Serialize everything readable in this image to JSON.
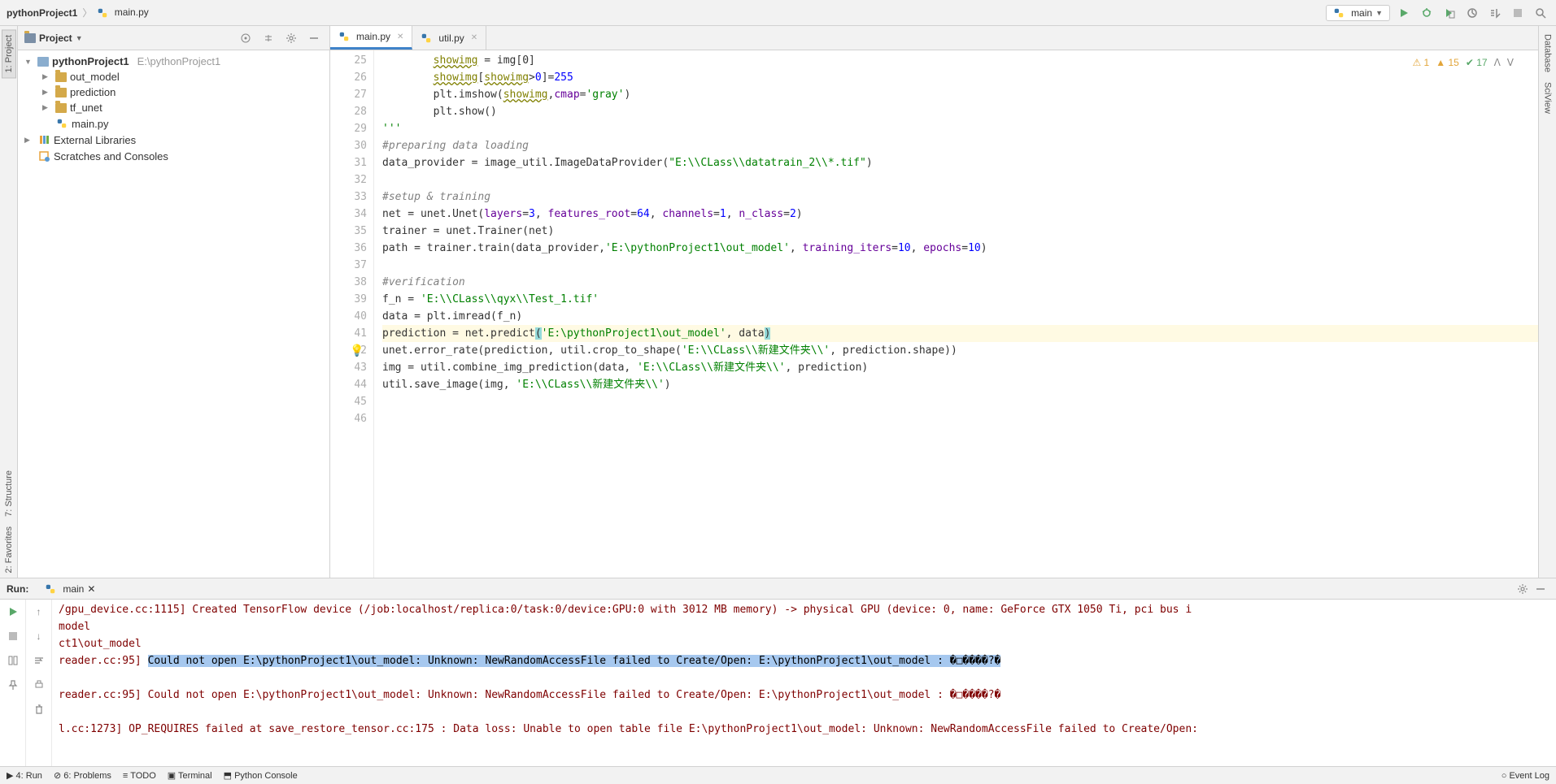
{
  "breadcrumb": {
    "project": "pythonProject1",
    "file": "main.py"
  },
  "runConfig": "main",
  "projectPanel": {
    "title": "Project",
    "root": {
      "name": "pythonProject1",
      "path": "E:\\pythonProject1"
    },
    "items": [
      {
        "name": "out_model",
        "type": "folder"
      },
      {
        "name": "prediction",
        "type": "folder"
      },
      {
        "name": "tf_unet",
        "type": "folder"
      },
      {
        "name": "main.py",
        "type": "py"
      }
    ],
    "external": "External Libraries",
    "scratches": "Scratches and Consoles"
  },
  "tabs": [
    {
      "label": "main.py",
      "active": true
    },
    {
      "label": "util.py",
      "active": false
    }
  ],
  "editorStatus": {
    "errors": "1",
    "warnings": "15",
    "ok": "17"
  },
  "codeLines": [
    {
      "n": 25,
      "segs": [
        {
          "t": "        ",
          "c": ""
        },
        {
          "t": "showimg",
          "c": "c-warn"
        },
        {
          "t": " = img[0]",
          "c": ""
        }
      ]
    },
    {
      "n": 26,
      "segs": [
        {
          "t": "        ",
          "c": ""
        },
        {
          "t": "showimg",
          "c": "c-warn"
        },
        {
          "t": "[",
          "c": ""
        },
        {
          "t": "showimg",
          "c": "c-warn"
        },
        {
          "t": ">",
          "c": ""
        },
        {
          "t": "0",
          "c": "c-num"
        },
        {
          "t": "]=",
          "c": ""
        },
        {
          "t": "255",
          "c": "c-num"
        }
      ]
    },
    {
      "n": 27,
      "segs": [
        {
          "t": "        plt.imshow(",
          "c": ""
        },
        {
          "t": "showimg",
          "c": "c-warn"
        },
        {
          "t": ",",
          "c": ""
        },
        {
          "t": "cmap",
          "c": "c-param"
        },
        {
          "t": "=",
          "c": ""
        },
        {
          "t": "'gray'",
          "c": "c-str"
        },
        {
          "t": ")",
          "c": ""
        }
      ]
    },
    {
      "n": 28,
      "segs": [
        {
          "t": "        plt.show()",
          "c": ""
        }
      ]
    },
    {
      "n": 29,
      "segs": [
        {
          "t": "'''",
          "c": "c-str"
        }
      ]
    },
    {
      "n": 30,
      "segs": [
        {
          "t": "#preparing data loading",
          "c": "c-comment"
        }
      ]
    },
    {
      "n": 31,
      "segs": [
        {
          "t": "data_provider = image_util.ImageDataProvider(",
          "c": ""
        },
        {
          "t": "\"E:\\\\CLass\\\\",
          "c": "c-str"
        },
        {
          "t": "datatrain_2",
          "c": "c-str"
        },
        {
          "t": "\\\\*.tif\"",
          "c": "c-str"
        },
        {
          "t": ")",
          "c": ""
        }
      ]
    },
    {
      "n": 32,
      "segs": [
        {
          "t": "",
          "c": ""
        }
      ]
    },
    {
      "n": 33,
      "segs": [
        {
          "t": "#setup & training",
          "c": "c-comment"
        }
      ]
    },
    {
      "n": 34,
      "segs": [
        {
          "t": "net = unet.Unet(",
          "c": ""
        },
        {
          "t": "layers",
          "c": "c-param"
        },
        {
          "t": "=",
          "c": ""
        },
        {
          "t": "3",
          "c": "c-num"
        },
        {
          "t": ", ",
          "c": ""
        },
        {
          "t": "features_root",
          "c": "c-param"
        },
        {
          "t": "=",
          "c": ""
        },
        {
          "t": "64",
          "c": "c-num"
        },
        {
          "t": ", ",
          "c": ""
        },
        {
          "t": "channels",
          "c": "c-param"
        },
        {
          "t": "=",
          "c": ""
        },
        {
          "t": "1",
          "c": "c-num"
        },
        {
          "t": ", ",
          "c": ""
        },
        {
          "t": "n_class",
          "c": "c-param"
        },
        {
          "t": "=",
          "c": ""
        },
        {
          "t": "2",
          "c": "c-num"
        },
        {
          "t": ")",
          "c": ""
        }
      ]
    },
    {
      "n": 35,
      "segs": [
        {
          "t": "trainer = unet.Trainer(net)",
          "c": ""
        }
      ]
    },
    {
      "n": 36,
      "segs": [
        {
          "t": "path = trainer.train(data_provider,",
          "c": ""
        },
        {
          "t": "'E:\\pythonProject1\\out_model'",
          "c": "c-str"
        },
        {
          "t": ", ",
          "c": ""
        },
        {
          "t": "training_iters",
          "c": "c-param"
        },
        {
          "t": "=",
          "c": ""
        },
        {
          "t": "10",
          "c": "c-num"
        },
        {
          "t": ", ",
          "c": ""
        },
        {
          "t": "epochs",
          "c": "c-param"
        },
        {
          "t": "=",
          "c": ""
        },
        {
          "t": "10",
          "c": "c-num"
        },
        {
          "t": ")",
          "c": ""
        }
      ]
    },
    {
      "n": 37,
      "segs": [
        {
          "t": "",
          "c": ""
        }
      ]
    },
    {
      "n": 38,
      "segs": [
        {
          "t": "#verification",
          "c": "c-comment"
        }
      ]
    },
    {
      "n": 39,
      "segs": [
        {
          "t": "f_n = ",
          "c": ""
        },
        {
          "t": "'E:\\\\CLass\\\\qyx\\\\Test_1.tif'",
          "c": "c-str"
        }
      ]
    },
    {
      "n": 40,
      "segs": [
        {
          "t": "data = plt.imread(f_n)",
          "c": ""
        }
      ]
    },
    {
      "n": 41,
      "current": true,
      "segs": [
        {
          "t": "prediction = net.predict",
          "c": ""
        },
        {
          "t": "(",
          "c": "bracket-hl"
        },
        {
          "t": "'E:\\pythonProject1\\out_model'",
          "c": "c-str"
        },
        {
          "t": ", data",
          "c": ""
        },
        {
          "t": ")",
          "c": "bracket-hl"
        }
      ]
    },
    {
      "n": 42,
      "segs": [
        {
          "t": "unet.error_rate(prediction, util.crop_to_shape(",
          "c": ""
        },
        {
          "t": "'E:\\\\CLass\\\\新建文件夹\\\\'",
          "c": "c-str"
        },
        {
          "t": ", prediction.shape))",
          "c": ""
        }
      ]
    },
    {
      "n": 43,
      "segs": [
        {
          "t": "img = util.combine_img_prediction(data, ",
          "c": ""
        },
        {
          "t": "'E:\\\\CLass\\\\新建文件夹\\\\'",
          "c": "c-str"
        },
        {
          "t": ", prediction)",
          "c": ""
        }
      ]
    },
    {
      "n": 44,
      "segs": [
        {
          "t": "util.save_image(img, ",
          "c": ""
        },
        {
          "t": "'E:\\\\CLass\\\\新建文件夹\\\\'",
          "c": "c-str"
        },
        {
          "t": ")",
          "c": ""
        }
      ]
    },
    {
      "n": 45,
      "segs": [
        {
          "t": "",
          "c": ""
        }
      ]
    },
    {
      "n": 46,
      "segs": [
        {
          "t": "",
          "c": ""
        }
      ]
    }
  ],
  "run": {
    "label": "Run:",
    "tab": "main",
    "lines": [
      {
        "t": "/gpu_device.cc:1115] Created TensorFlow device (/job:localhost/replica:0/task:0/device:GPU:0 with 3012 MB memory) -> physical GPU (device: 0, name: GeForce GTX 1050 Ti, pci bus i"
      },
      {
        "t": "model"
      },
      {
        "t": "ct1\\out_model"
      },
      {
        "pre": "reader.cc:95] ",
        "sel": "Could not open E:\\pythonProject1\\out_model: Unknown: NewRandomAccessFile failed to Create/Open: E:\\pythonProject1\\out_model : �□����?�"
      },
      {
        "t": ""
      },
      {
        "t": "reader.cc:95] Could not open E:\\pythonProject1\\out_model: Unknown: NewRandomAccessFile failed to Create/Open: E:\\pythonProject1\\out_model : �□����?�"
      },
      {
        "t": ""
      },
      {
        "t": "l.cc:1273] OP_REQUIRES failed at save_restore_tensor.cc:175 : Data loss: Unable to open table file E:\\pythonProject1\\out_model: Unknown: NewRandomAccessFile failed to Create/Open:"
      }
    ]
  },
  "bottomBar": {
    "run": "4: Run",
    "problems": "6: Problems",
    "todo": "TODO",
    "terminal": "Terminal",
    "pyconsole": "Python Console",
    "eventLog": "Event Log"
  },
  "leftTabs": {
    "project": "1: Project",
    "structure": "7: Structure",
    "favorites": "2: Favorites"
  },
  "rightTabs": {
    "database": "Database",
    "sciview": "SciView"
  }
}
